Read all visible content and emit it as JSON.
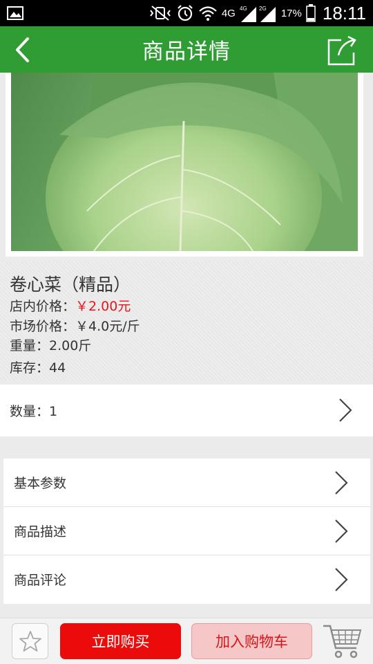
{
  "status_bar": {
    "network_label": "4G",
    "sim1_label": "4G",
    "sim2_label": "2G",
    "battery_percent": "17%",
    "time": "18:11",
    "icons": [
      "image-icon",
      "mute-vibrate-icon",
      "alarm-icon",
      "wifi-icon",
      "signal-icon",
      "battery-icon"
    ]
  },
  "header": {
    "title": "商品详情",
    "back_icon": "chevron-left-icon",
    "share_icon": "share-icon",
    "background_color": "#2f9c34"
  },
  "product": {
    "name": "卷心菜（精品）",
    "store_price_label": "店内价格：",
    "store_price": "￥2.00元",
    "market_price": "市场价格：￥4.0元/斤",
    "weight": "重量：2.00斤",
    "stock": "库存：44",
    "price_color": "#e8141b"
  },
  "quantity": {
    "label": "数量：1"
  },
  "menu": {
    "items": [
      {
        "label": "基本参数"
      },
      {
        "label": "商品描述"
      },
      {
        "label": "商品评论"
      }
    ]
  },
  "bottom_bar": {
    "favorite_icon": "star-icon",
    "buy_now_label": "立即购买",
    "add_to_cart_label": "加入购物车",
    "cart_icon": "shopping-cart-icon",
    "buy_color": "#ec0b0b"
  }
}
